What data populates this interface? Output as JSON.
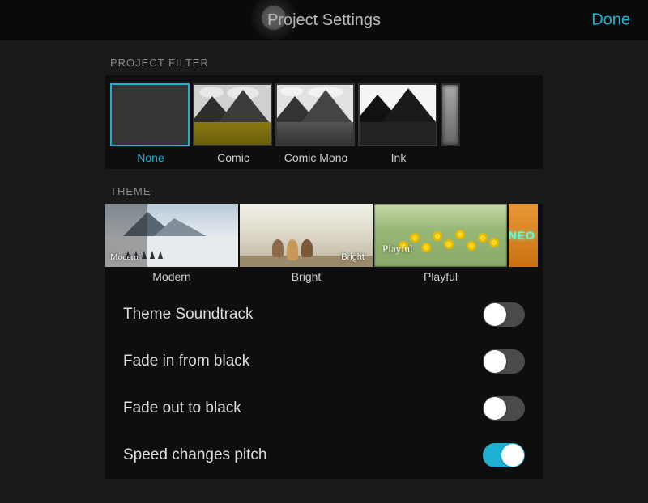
{
  "header": {
    "title": "Project Settings",
    "done_label": "Done"
  },
  "sections": {
    "filter_label": "PROJECT FILTER",
    "theme_label": "THEME"
  },
  "filters": [
    {
      "label": "None",
      "selected": true
    },
    {
      "label": "Comic",
      "selected": false
    },
    {
      "label": "Comic Mono",
      "selected": false
    },
    {
      "label": "Ink",
      "selected": false
    }
  ],
  "themes": [
    {
      "label": "Modern",
      "caption": "Modern"
    },
    {
      "label": "Bright",
      "caption": "Bright"
    },
    {
      "label": "Playful",
      "caption": "Playful"
    },
    {
      "label": "",
      "caption": "NEO"
    }
  ],
  "settings": [
    {
      "label": "Theme Soundtrack",
      "on": false
    },
    {
      "label": "Fade in from black",
      "on": false
    },
    {
      "label": "Fade out to black",
      "on": false
    },
    {
      "label": "Speed changes pitch",
      "on": true
    }
  ],
  "colors": {
    "accent": "#1fb1d4"
  }
}
